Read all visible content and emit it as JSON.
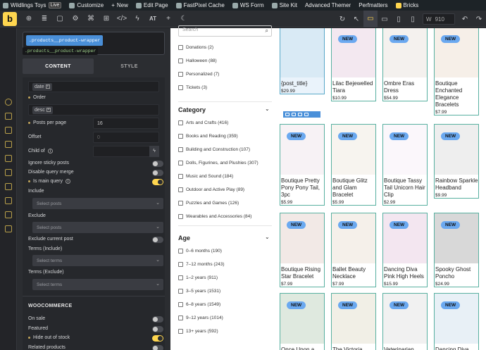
{
  "wpbar": {
    "site": "Wildlings Toys",
    "live": "Live",
    "customize": "Customize",
    "new": "New",
    "edit": "Edit Page",
    "cache": "FastPixel Cache",
    "wsform": "WS Form",
    "sitekit": "Site Kit",
    "themer": "Advanced Themer",
    "perf": "Perfmatters",
    "bricks": "Bricks"
  },
  "toolbar": {
    "logo": "b",
    "at": "AT",
    "width": "910"
  },
  "panel": {
    "selector": ".products__product-wrapper",
    "selector2": ".products__product-wrapper",
    "tab_content": "CONTENT",
    "tab_style": "STYLE",
    "orderby_value": "date",
    "order_label": "Order",
    "order_value": "desc",
    "posts_per_page_label": "Posts per page",
    "posts_per_page": "16",
    "offset_label": "Offset",
    "offset_placeholder": "0",
    "child_of_label": "Child of",
    "ignore_sticky_label": "Ignore sticky posts",
    "disable_merge_label": "Disable query merge",
    "main_query_label": "Is main query",
    "include_label": "Include",
    "include_placeholder": "Select posts",
    "exclude_label": "Exclude",
    "exclude_placeholder": "Select posts",
    "exclude_current_label": "Exclude current post",
    "terms_include_label": "Terms (Include)",
    "terms_include_placeholder": "Select terms",
    "terms_exclude_label": "Terms (Exclude)",
    "terms_exclude_placeholder": "Select terms",
    "woo_section": "WOOCOMMERCE",
    "on_sale_label": "On sale",
    "featured_label": "Featured",
    "hide_oos_label": "Hide out of stock",
    "related_label": "Related products"
  },
  "filters": {
    "search_placeholder": "Search",
    "tags": [
      "Donations (2)",
      "Halloween (88)",
      "Personalized (7)",
      "Tickets (3)"
    ],
    "category_title": "Category",
    "categories": [
      "Arts and Crafts (416)",
      "Books and Reading (359)",
      "Building and Construction (107)",
      "Dolls, Figurines, and Plushies (307)",
      "Music and Sound (184)",
      "Outdoor and Active Play (89)",
      "Puzzles and Games (126)",
      "Wearables and Accessories (84)"
    ],
    "age_title": "Age",
    "ages": [
      "0–6 months (190)",
      "7–12 months (243)",
      "1–2 years (911)",
      "3–5 years (1531)",
      "6–8 years (1549)",
      "9–12 years (1014)",
      "13+ years (592)"
    ]
  },
  "products": [
    {
      "name": "{post_title}",
      "price": "$29.99",
      "badge": ""
    },
    {
      "name": "Lilac Bejewelled Tiara",
      "price": "$10.99",
      "badge": "NEW"
    },
    {
      "name": "Ombre Eras Dress",
      "price": "$54.99",
      "badge": "NEW"
    },
    {
      "name": "Boutique Enchanted Elegance Bracelets",
      "price": "$7.99",
      "badge": "NEW"
    },
    {
      "name": "Boutique Pretty Pony Pony Tail, 3pc",
      "price": "$5.99",
      "badge": "NEW"
    },
    {
      "name": "Boutique Glitz and Glam Bracelet",
      "price": "$5.99",
      "badge": "NEW"
    },
    {
      "name": "Boutique Tassy Tail Unicorn Hair Clip",
      "price": "$2.99",
      "badge": "NEW"
    },
    {
      "name": "Rainbow Sparkle Headband",
      "price": "$9.99",
      "badge": "NEW"
    },
    {
      "name": "Boutique Rising Star Bracelet",
      "price": "$7.99",
      "badge": "NEW"
    },
    {
      "name": "Ballet Beauty Necklace",
      "price": "$7.99",
      "badge": "NEW"
    },
    {
      "name": "Dancing Diva Pink High Heels",
      "price": "$15.99",
      "badge": "NEW"
    },
    {
      "name": "Spooky Ghost Poncho",
      "price": "$24.99",
      "badge": "NEW"
    },
    {
      "name": "Once Upon a",
      "price": "",
      "badge": "NEW"
    },
    {
      "name": "The Victoria",
      "price": "",
      "badge": "NEW"
    },
    {
      "name": "Veterinarian",
      "price": "",
      "badge": "NEW"
    },
    {
      "name": "Dancing Diva",
      "price": "",
      "badge": "NEW"
    }
  ],
  "colors": {
    "accent": "#ffd64f",
    "select": "#4a8fd8",
    "badge": "#6ba9f0",
    "border": "#58b0a0"
  }
}
